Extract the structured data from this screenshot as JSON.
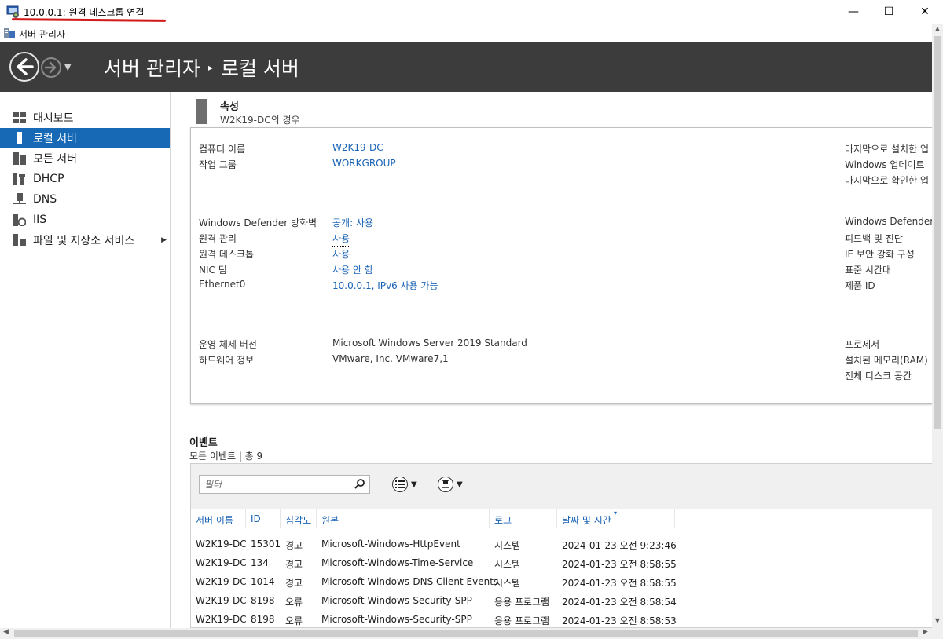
{
  "window": {
    "title": "10.0.0.1: 원격 데스크톱 연결",
    "minimize": "—",
    "maximize": "☐",
    "close": "✕"
  },
  "app": {
    "name": "서버 관리자"
  },
  "header": {
    "crumb_root": "서버 관리자",
    "separator": "▸",
    "crumb_current": "로컬 서버"
  },
  "sidebar": {
    "items": [
      {
        "label": "대시보드",
        "icon": "dashboard-icon"
      },
      {
        "label": "로컬 서버",
        "icon": "server-icon",
        "active": true
      },
      {
        "label": "모든 서버",
        "icon": "servers-icon"
      },
      {
        "label": "DHCP",
        "icon": "dhcp-icon"
      },
      {
        "label": "DNS",
        "icon": "dns-icon"
      },
      {
        "label": "IIS",
        "icon": "iis-icon"
      },
      {
        "label": "파일 및 저장소 서비스",
        "icon": "storage-icon",
        "expand": "▶"
      }
    ]
  },
  "properties": {
    "title": "속성",
    "subtitle": "W2K19-DC의 경우",
    "rows": [
      {
        "label": "컴퓨터 이름",
        "value": "W2K19-DC"
      },
      {
        "label": "작업 그룹",
        "value": "WORKGROUP"
      },
      {
        "label": "Windows Defender 방화벽",
        "value": "공개: 사용"
      },
      {
        "label": "원격 관리",
        "value": "사용"
      },
      {
        "label": "원격 데스크톱",
        "value": "사용"
      },
      {
        "label": "NIC 팀",
        "value": "사용 안 함"
      },
      {
        "label": "Ethernet0",
        "value": "10.0.0.1, IPv6 사용 가능"
      },
      {
        "label": "운영 체제 버전",
        "value": "Microsoft Windows Server 2019 Standard"
      },
      {
        "label": "하드웨어 정보",
        "value": "VMware, Inc. VMware7,1"
      }
    ],
    "right_labels": [
      "마지막으로 설치한 업",
      "Windows 업데이트",
      "마지막으로 확인한 업",
      "Windows Defender",
      "피드백 및 진단",
      "IE 보안 강화 구성",
      "표준 시간대",
      "제품 ID",
      "프로세서",
      "설치된 메모리(RAM)",
      "전체 디스크 공간"
    ]
  },
  "events": {
    "title": "이벤트",
    "subtitle": "모든 이벤트 | 총 9",
    "filter_placeholder": "필터",
    "columns": [
      "서버 이름",
      "ID",
      "심각도",
      "원본",
      "로그",
      "날짜 및 시간"
    ],
    "sort_indicator": "▾",
    "rows": [
      [
        "W2K19-DC",
        "15301",
        "경고",
        "Microsoft-Windows-HttpEvent",
        "시스템",
        "2024-01-23 오전 9:23:46"
      ],
      [
        "W2K19-DC",
        "134",
        "경고",
        "Microsoft-Windows-Time-Service",
        "시스템",
        "2024-01-23 오전 8:58:55"
      ],
      [
        "W2K19-DC",
        "1014",
        "경고",
        "Microsoft-Windows-DNS Client Events",
        "시스템",
        "2024-01-23 오전 8:58:55"
      ],
      [
        "W2K19-DC",
        "8198",
        "오류",
        "Microsoft-Windows-Security-SPP",
        "응용 프로그램",
        "2024-01-23 오전 8:58:54"
      ],
      [
        "W2K19-DC",
        "8198",
        "오류",
        "Microsoft-Windows-Security-SPP",
        "응용 프로그램",
        "2024-01-23 오전 8:58:53"
      ]
    ]
  },
  "colors": {
    "accent": "#1769b5",
    "header_bg": "#3c3c3c",
    "link": "#1a63b5"
  }
}
